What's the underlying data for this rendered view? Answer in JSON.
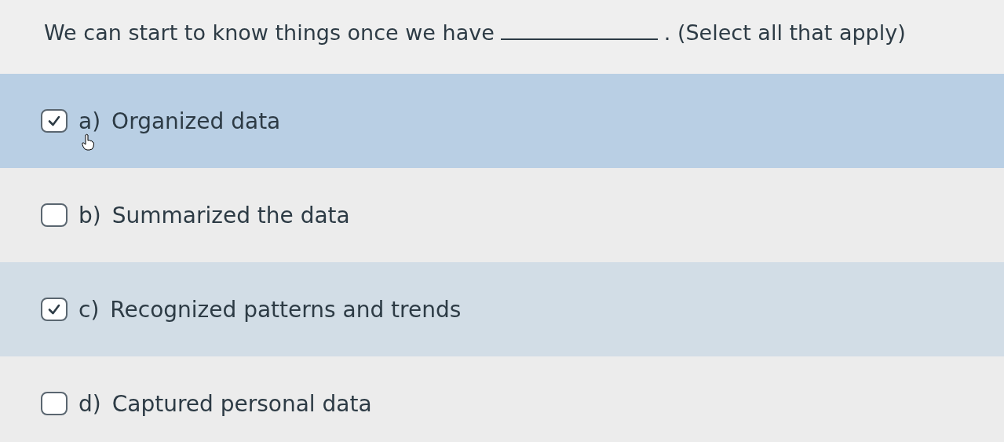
{
  "question": {
    "before": "We can start to know things once we have",
    "after": ". (Select all that apply)"
  },
  "options": [
    {
      "letter": "a)",
      "text": "Organized data",
      "checked": true,
      "hovered": true
    },
    {
      "letter": "b)",
      "text": "Summarized the data",
      "checked": false,
      "hovered": false
    },
    {
      "letter": "c)",
      "text": "Recognized patterns and trends",
      "checked": true,
      "hovered": false
    },
    {
      "letter": "d)",
      "text": "Captured personal data",
      "checked": false,
      "hovered": false
    }
  ]
}
